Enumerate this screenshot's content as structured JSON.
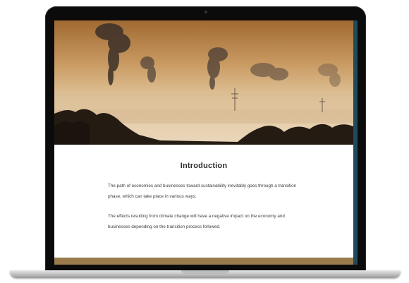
{
  "article": {
    "title": "Introduction",
    "paragraph_1": "The path of economies and businesses toward sustainability inevitably goes through a transition phase, which can take place in various ways.",
    "paragraph_2": "The effects resulting from climate change will have a negative impact on the economy and businesses depending on the transition process followed."
  },
  "colors": {
    "accent_band": "#9a7b4c",
    "screen_edge": "#1e4a5c"
  }
}
